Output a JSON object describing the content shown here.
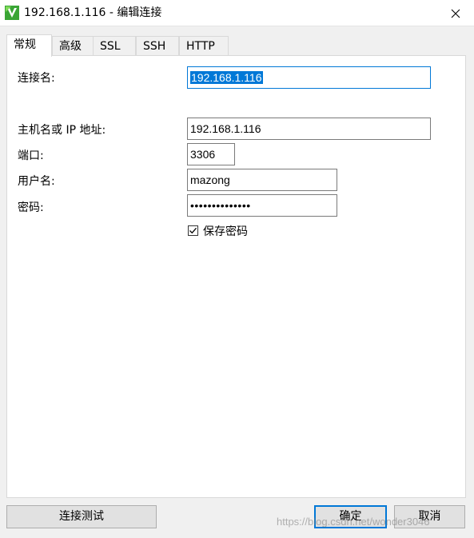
{
  "window": {
    "title": "192.168.1.116 - 编辑连接"
  },
  "tabs": [
    {
      "label": "常规",
      "active": true
    },
    {
      "label": "高级",
      "active": false
    },
    {
      "label": "SSL",
      "active": false
    },
    {
      "label": "SSH",
      "active": false
    },
    {
      "label": "HTTP",
      "active": false
    }
  ],
  "form": {
    "connection_name_label": "连接名:",
    "connection_name_value": "192.168.1.116",
    "host_label": "主机名或 IP 地址:",
    "host_value": "192.168.1.116",
    "port_label": "端口:",
    "port_value": "3306",
    "username_label": "用户名:",
    "username_value": "mazong",
    "password_label": "密码:",
    "password_value": "••••••••••••••",
    "save_password_label": "保存密码",
    "save_password_checked": true
  },
  "buttons": {
    "test_connection": "连接测试",
    "ok": "确定",
    "cancel": "取消"
  },
  "watermark": "https://blog.csdn.net/wonder3046",
  "colors": {
    "accent": "#0078d7",
    "icon_green": "#3aa535"
  }
}
